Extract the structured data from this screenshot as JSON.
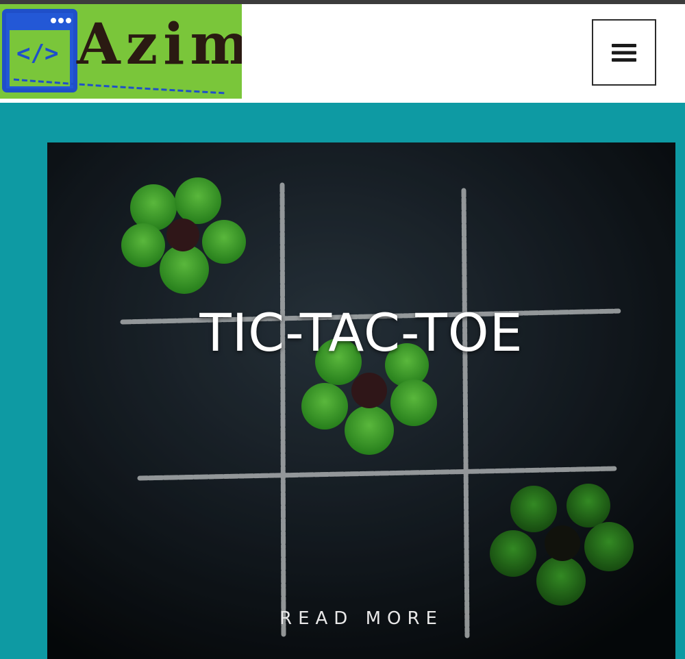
{
  "header": {
    "logo": {
      "code_symbol": "</>",
      "name": "Azim"
    },
    "menu_icon": "hamburger-menu-icon"
  },
  "post": {
    "title": "TIC-TAC-TOE",
    "read_more_label": "READ MORE",
    "image_subject": "chalk tic-tac-toe grid with green four-leaf clovers on dark slate"
  },
  "colors": {
    "top_strip": "#3c3c3c",
    "header_bg": "#ffffff",
    "logo_bg": "#7ac63a",
    "logo_window": "#1f4fc9",
    "logo_text": "#2a1a12",
    "page_bg": "#0e9aa3",
    "card_bg": "#0b1013",
    "title_text": "#ffffff"
  }
}
